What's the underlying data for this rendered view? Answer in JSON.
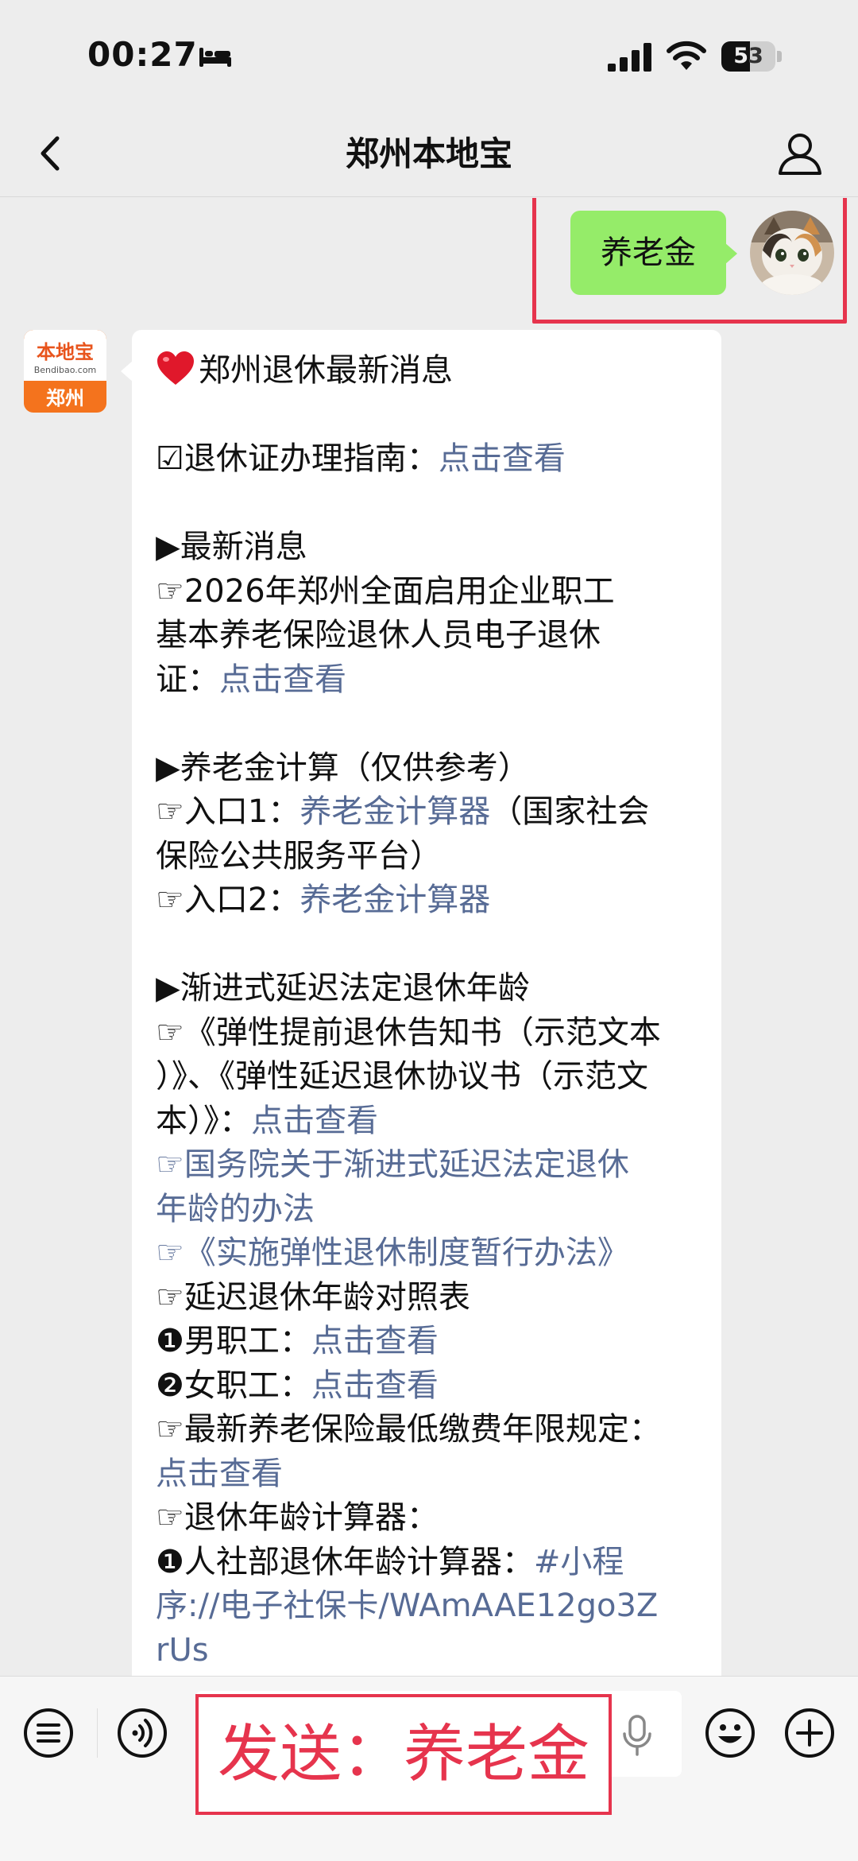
{
  "status_bar": {
    "time": "00:27",
    "battery_level": "53",
    "battery_fraction": 0.53,
    "icons": [
      "bed-icon",
      "cellular-signal-icon",
      "wifi-icon",
      "battery-icon"
    ]
  },
  "nav": {
    "title": "郑州本地宝",
    "back_icon": "chevron-left-icon",
    "profile_icon": "person-icon"
  },
  "outgoing_message": {
    "text": "养老金",
    "bubble_color": "#95ec69",
    "avatar": "cat-avatar"
  },
  "bot": {
    "avatar_brand": "本地宝",
    "avatar_url": "Bendibao.com",
    "avatar_city": "郑州",
    "avatar_color": "#f4731d"
  },
  "reply": {
    "title": "郑州退休最新消息",
    "title_icon": "heart-icon",
    "guide_label": "☑退休证办理指南：",
    "guide_link": "点击查看",
    "s1_heading": "▶最新消息",
    "s1_line1": "☞2026年郑州全面启用企业职工",
    "s1_line2": "基本养老保险退休人员电子退休",
    "s1_line3_text": "证：",
    "s1_line3_link": "点击查看",
    "s2_heading": "▶养老金计算（仅供参考）",
    "s2_entry1_label": "☞入口1：",
    "s2_entry1_link": "养老金计算器",
    "s2_entry1_suffix": "（国家社会",
    "s2_entry1_line2": "保险公共服务平台）",
    "s2_entry2_label": "☞入口2：",
    "s2_entry2_link": "养老金计算器",
    "s3_heading": "▶渐进式延迟法定退休年龄",
    "s3_doc_line1": "☞《弹性提前退休告知书（示范文本",
    "s3_doc_line2": "）》、《弹性延迟退休协议书（示范文",
    "s3_doc_line3_text": "本）》：",
    "s3_doc_line3_link": "点击查看",
    "s3_state_bullet": "☞",
    "s3_state_link1": "国务院关于渐进式延迟法定退休",
    "s3_state_link2": "年龄的办法",
    "s3_flex_bullet": "☞",
    "s3_flex_link": "《实施弹性退休制度暂行办法》",
    "s3_table": "☞延迟退休年龄对照表",
    "s3_male_label": "❶男职工：",
    "s3_male_link": "点击查看",
    "s3_female_label": "❷女职工：",
    "s3_female_link": "点击查看",
    "s3_min_years": "☞最新养老保险最低缴费年限规定：",
    "s3_min_years_link": "点击查看",
    "s3_calc": "☞退休年龄计算器：",
    "s3_calc1_label": "❶人社部退休年龄计算器：",
    "s3_calc1_link_a": "#小程",
    "s3_calc1_link_b": "序://电子社保卡/WAmAAE12go3Z",
    "s3_calc1_link_c": "rUs",
    "link_color": "#576b95"
  },
  "input_bar": {
    "menu_icon": "menu-list-icon",
    "voice_icon": "voice-wave-icon",
    "mic_icon": "microphone-icon",
    "emoji_icon": "smiley-icon",
    "add_icon": "plus-circle-icon",
    "send_overlay": "发送：养老金",
    "annotation_color": "#e6344d"
  }
}
